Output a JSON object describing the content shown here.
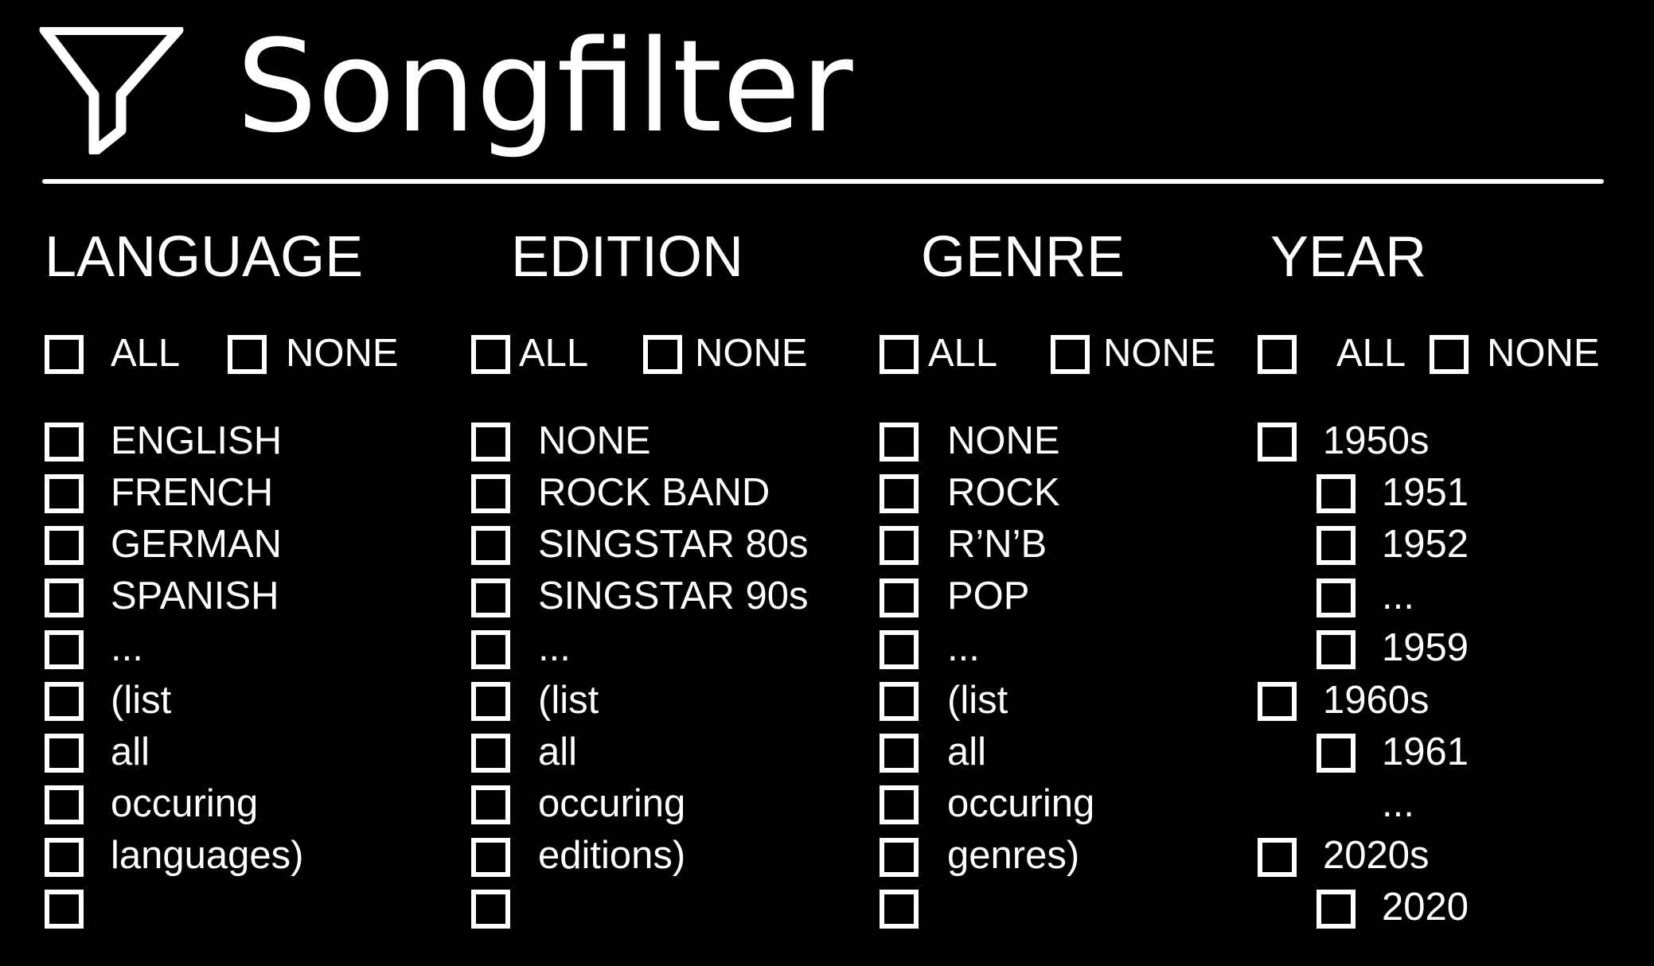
{
  "app": {
    "title": "Songfilter",
    "icon": "filter-funnel-icon"
  },
  "colors": {
    "background": "#000000",
    "foreground": "#ffffff"
  },
  "columns": [
    {
      "key": "language",
      "header": "LANGUAGE",
      "all_label": "ALL",
      "none_label": "NONE",
      "items": [
        {
          "label": "ENGLISH",
          "checked": false
        },
        {
          "label": "FRENCH",
          "checked": false
        },
        {
          "label": "GERMAN",
          "checked": false
        },
        {
          "label": "SPANISH",
          "checked": false
        },
        {
          "label": "...",
          "checked": false
        },
        {
          "label": "(list",
          "checked": false
        },
        {
          "label": "all",
          "checked": false
        },
        {
          "label": "occuring",
          "checked": false
        },
        {
          "label": "languages)",
          "checked": false
        },
        {
          "label": "",
          "checked": false
        }
      ]
    },
    {
      "key": "edition",
      "header": "EDITION",
      "all_label": "ALL",
      "none_label": "NONE",
      "items": [
        {
          "label": "NONE",
          "checked": false
        },
        {
          "label": "ROCK BAND",
          "checked": false
        },
        {
          "label": "SINGSTAR 80s",
          "checked": false
        },
        {
          "label": "SINGSTAR 90s",
          "checked": false
        },
        {
          "label": "...",
          "checked": false
        },
        {
          "label": "(list",
          "checked": false
        },
        {
          "label": "all",
          "checked": false
        },
        {
          "label": "occuring",
          "checked": false
        },
        {
          "label": "editions)",
          "checked": false
        },
        {
          "label": "",
          "checked": false
        }
      ]
    },
    {
      "key": "genre",
      "header": "GENRE",
      "all_label": "ALL",
      "none_label": "NONE",
      "items": [
        {
          "label": "NONE",
          "checked": false
        },
        {
          "label": "ROCK",
          "checked": false
        },
        {
          "label": "R’N’B",
          "checked": false
        },
        {
          "label": "POP",
          "checked": false
        },
        {
          "label": "...",
          "checked": false
        },
        {
          "label": "(list",
          "checked": false
        },
        {
          "label": "all",
          "checked": false
        },
        {
          "label": "occuring",
          "checked": false
        },
        {
          "label": "genres)",
          "checked": false
        },
        {
          "label": "",
          "checked": false
        }
      ]
    },
    {
      "key": "year",
      "header": "YEAR",
      "all_label": "ALL",
      "none_label": "NONE",
      "items": [
        {
          "label": "1950s",
          "level": 0,
          "checkbox": true,
          "checked": false
        },
        {
          "label": "1951",
          "level": 1,
          "checkbox": true,
          "checked": false
        },
        {
          "label": "1952",
          "level": 1,
          "checkbox": true,
          "checked": false
        },
        {
          "label": "...",
          "level": 1,
          "checkbox": true,
          "checked": false
        },
        {
          "label": "1959",
          "level": 1,
          "checkbox": true,
          "checked": false
        },
        {
          "label": "1960s",
          "level": 0,
          "checkbox": true,
          "checked": false
        },
        {
          "label": "1961",
          "level": 1,
          "checkbox": true,
          "checked": false
        },
        {
          "label": "...",
          "level": 1,
          "checkbox": false,
          "checked": false
        },
        {
          "label": "2020s",
          "level": 0,
          "checkbox": true,
          "checked": false
        },
        {
          "label": "2020",
          "level": 1,
          "checkbox": true,
          "checked": false
        }
      ]
    }
  ]
}
